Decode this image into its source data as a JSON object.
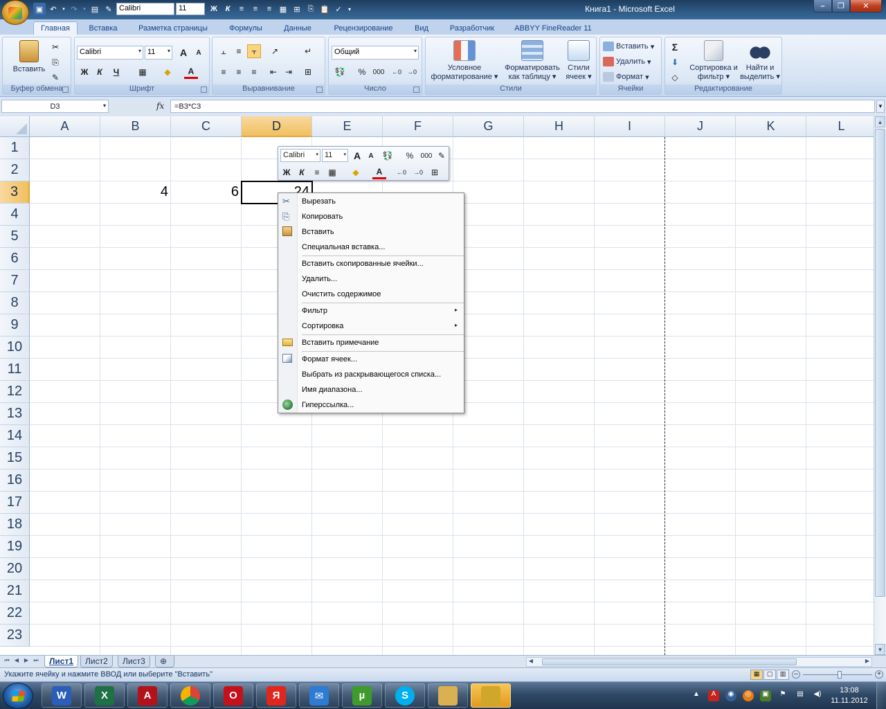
{
  "window": {
    "title": "Книга1 - Microsoft Excel",
    "minimize": "–",
    "maximize": "❐",
    "close": "✕"
  },
  "qat": {
    "font": "Calibri",
    "size": "11",
    "bold": "Ж",
    "italic": "К"
  },
  "tabs": [
    {
      "label": "Главная"
    },
    {
      "label": "Вставка"
    },
    {
      "label": "Разметка страницы"
    },
    {
      "label": "Формулы"
    },
    {
      "label": "Данные"
    },
    {
      "label": "Рецензирование"
    },
    {
      "label": "Вид"
    },
    {
      "label": "Разработчик"
    },
    {
      "label": "ABBYY FineReader 11"
    }
  ],
  "ribbon": {
    "clipboard": {
      "paste": "Вставить",
      "label": "Буфер обмена"
    },
    "font": {
      "name": "Calibri",
      "size": "11",
      "grow": "A",
      "shrink": "A",
      "bold": "Ж",
      "italic": "К",
      "underline": "Ч",
      "color_letter": "A",
      "label": "Шрифт"
    },
    "alignment": {
      "label": "Выравнивание"
    },
    "number": {
      "format": "Общий",
      "percent": "%",
      "thousands": "000",
      "label": "Число"
    },
    "styles": {
      "conditional": "Условное форматирование",
      "as_table": "Форматировать как таблицу",
      "cell_styles": "Стили ячеек",
      "label": "Стили"
    },
    "cells": {
      "insert": "Вставить",
      "delete": "Удалить",
      "format": "Формат",
      "label": "Ячейки"
    },
    "editing": {
      "sum": "Σ",
      "sort": "Сортировка и фильтр",
      "find": "Найти и выделить",
      "label": "Редактирование"
    }
  },
  "formula_bar": {
    "name_box": "D3",
    "fx": "fx",
    "formula": "=B3*C3"
  },
  "columns": [
    "A",
    "B",
    "C",
    "D",
    "E",
    "F",
    "G",
    "H",
    "I",
    "J",
    "K",
    "L"
  ],
  "rows": [
    "1",
    "2",
    "3",
    "4",
    "5",
    "6",
    "7",
    "8",
    "9",
    "10",
    "11",
    "12",
    "13",
    "14",
    "15",
    "16",
    "17",
    "18",
    "19",
    "20",
    "21",
    "22",
    "23"
  ],
  "cells": {
    "B3": "4",
    "C3": "6",
    "D3": "24"
  },
  "selection": {
    "column": "D",
    "row": "3"
  },
  "mini_toolbar": {
    "font": "Calibri",
    "size": "11",
    "grow": "A",
    "shrink": "A",
    "percent": "%",
    "thousands": "000",
    "bold": "Ж",
    "italic": "К",
    "color_letter": "A"
  },
  "context_menu": [
    {
      "label": "Вырезать",
      "icon": "scissors-icon"
    },
    {
      "label": "Копировать",
      "icon": "copy-icon"
    },
    {
      "label": "Вставить",
      "icon": "paste-icon"
    },
    {
      "label": "Специальная вставка..."
    },
    {
      "label": "Вставить скопированные ячейки..."
    },
    {
      "label": "Удалить..."
    },
    {
      "label": "Очистить содержимое"
    },
    {
      "label": "Фильтр",
      "submenu": "▸"
    },
    {
      "label": "Сортировка",
      "submenu": "▸"
    },
    {
      "label": "Вставить примечание",
      "icon": "comment-icon"
    },
    {
      "label": "Формат ячеек...",
      "icon": "format-cells-icon"
    },
    {
      "label": "Выбрать из раскрывающегося списка..."
    },
    {
      "label": "Имя диапазона..."
    },
    {
      "label": "Гиперссылка...",
      "icon": "hyperlink-icon"
    }
  ],
  "sheets": [
    {
      "label": "Лист1"
    },
    {
      "label": "Лист2"
    },
    {
      "label": "Лист3"
    }
  ],
  "status_text": "Укажите ячейку и нажмите ВВОД или выберите \"Вставить\"",
  "taskbar": {
    "apps": [
      {
        "icon": "word-icon",
        "letter": "W"
      },
      {
        "icon": "excel-icon",
        "letter": "X"
      },
      {
        "icon": "acrobat-icon",
        "letter": "A"
      },
      {
        "icon": "chrome-icon",
        "letter": ""
      },
      {
        "icon": "opera-icon",
        "letter": "O"
      },
      {
        "icon": "yandex-icon",
        "letter": "Я"
      },
      {
        "icon": "mail-icon",
        "letter": "✉"
      },
      {
        "icon": "utorrent-icon",
        "letter": "µ"
      },
      {
        "icon": "skype-icon",
        "letter": "S"
      },
      {
        "icon": "explorer-icon",
        "letter": ""
      },
      {
        "icon": "antivirus-icon",
        "letter": ""
      }
    ],
    "time": "13:08",
    "date": "11.11.2012"
  },
  "colors": {
    "accent": "#15428b",
    "selection_header": "#f1c05f",
    "excel_green": "#1e7145"
  }
}
